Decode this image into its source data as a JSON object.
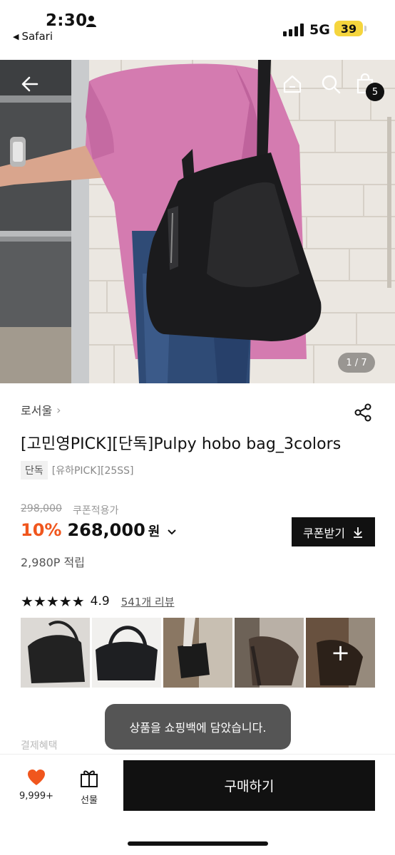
{
  "status_bar": {
    "time": "2:30",
    "back_app": "Safari",
    "network": "5G",
    "battery": "39"
  },
  "hero": {
    "cart_count": "5",
    "pager": "1 / 7"
  },
  "product": {
    "brand": "로서울",
    "title": "[고민영PICK][단독]Pulpy hobo bag_3colors",
    "tag_exclusive": "단독",
    "tag_others": "[유하PICK][25SS]",
    "original_price": "298,000",
    "coupon_applied": "쿠폰적용가",
    "discount": "10%",
    "price": "268,000",
    "currency": "원",
    "coupon_button": "쿠폰받기",
    "points": "2,980P 적립",
    "rating": "4.9",
    "star_count": 5,
    "review_link": "541개 리뷰"
  },
  "thumbnails": [
    {
      "name": "review-photo-1",
      "tone": "#d9d6d2"
    },
    {
      "name": "review-photo-2",
      "tone": "#efeeec"
    },
    {
      "name": "review-photo-3",
      "tone": "#8a7a66"
    },
    {
      "name": "review-photo-4",
      "tone": "#b5aca2"
    },
    {
      "name": "review-photo-5",
      "tone": "#8c6f57"
    }
  ],
  "faded_label": "결제혜택",
  "toast": "상품을 쇼핑백에 담았습니다.",
  "bottom_bar": {
    "wish_count": "9,999+",
    "gift_label": "선물",
    "buy_label": "구매하기"
  },
  "icons": {
    "back": "arrow-left-icon",
    "home": "home-icon",
    "search": "search-icon",
    "cart": "shopping-bag-icon",
    "share": "share-icon",
    "heart": "heart-icon",
    "gift": "gift-icon",
    "download": "download-icon"
  },
  "colors": {
    "accent_discount": "#f0561d",
    "heart": "#f0561d",
    "battery": "#f5d53d",
    "buy_button": "#111111"
  }
}
